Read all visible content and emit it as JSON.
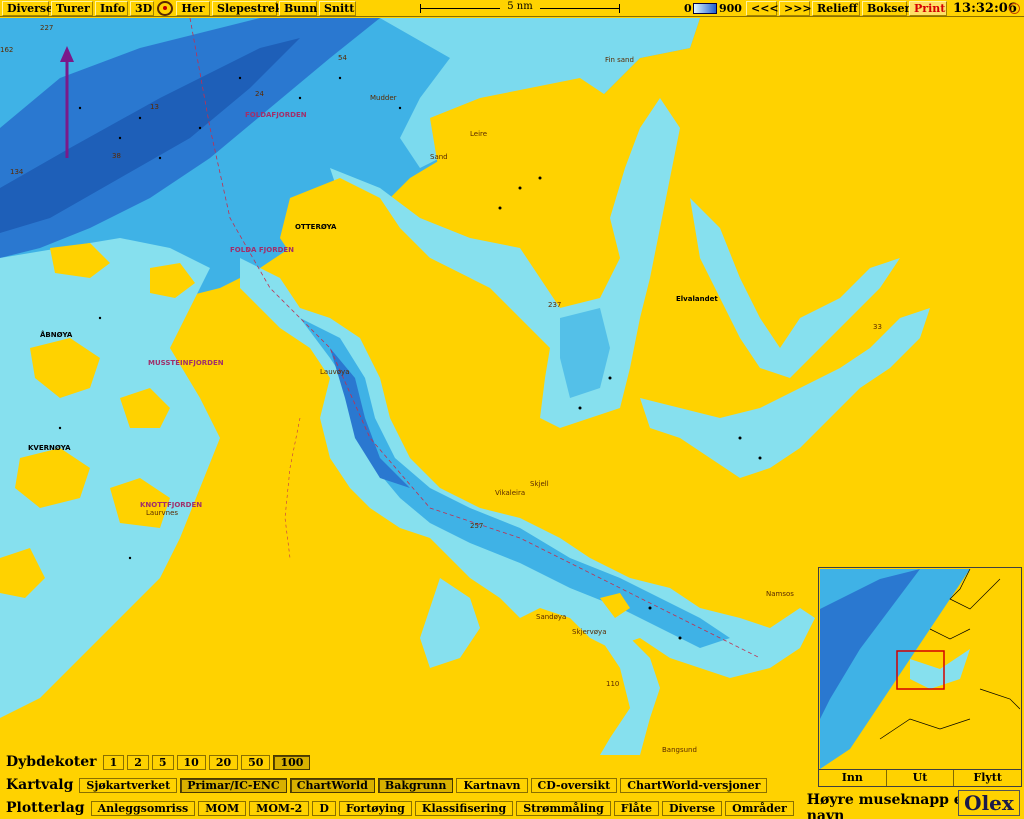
{
  "toolbar": {
    "buttons": [
      "Diverse",
      "Turer",
      "Info",
      "3D",
      "Her",
      "Slepestrek",
      "Bunn",
      "Snitt"
    ],
    "scale_label": "5 nm",
    "depth_min": "0",
    "depth_max": "900",
    "prev_label": "<<<",
    "next_label": ">>>",
    "relief_label": "Relieff",
    "boxes_label": "Bokser",
    "print_label": "Print",
    "clock": "13:32:06"
  },
  "map": {
    "place_names": [
      "FOLDAFJORDEN",
      "OTTERØYA",
      "ÅBNØYA",
      "KVERNØYA",
      "MUSSTEINFJORDEN",
      "KNOTTFJORDEN",
      "FOLDA FJORDEN",
      "Namsos",
      "Bangsund",
      "Skjervøya",
      "Leire",
      "Mudder",
      "Sand",
      "Skjell",
      "Fin sand",
      "Laurvnes",
      "Elvalandet",
      "Lauvøya",
      "Sandøya",
      "Vikaleira"
    ],
    "depth_soundings": [
      "227",
      "162",
      "134",
      "24",
      "54",
      "13",
      "38",
      "237",
      "110",
      "257",
      "33"
    ]
  },
  "inset": {
    "zoom_in_label": "Inn",
    "zoom_out_label": "Ut",
    "move_label": "Flytt"
  },
  "depth_contours": {
    "title": "Dybdekoter",
    "options": [
      "1",
      "2",
      "5",
      "10",
      "20",
      "50",
      "100"
    ],
    "selected": "100"
  },
  "chart_select": {
    "title": "Kartvalg",
    "options": [
      "Sjøkartverket",
      "Primar/IC-ENC",
      "ChartWorld",
      "Bakgrunn",
      "Kartnavn",
      "CD-oversikt",
      "ChartWorld-versjoner"
    ],
    "active": [
      "Primar/IC-ENC",
      "ChartWorld",
      "Bakgrunn"
    ]
  },
  "plot_layers": {
    "title": "Plotterlag",
    "options": [
      "Anleggsomriss",
      "MOM",
      "MOM-2",
      "D",
      "Fortøying",
      "Klassifisering",
      "Strømmåling",
      "Flåte",
      "Diverse",
      "Områder"
    ],
    "hint": "Høyre museknapp endrer navn"
  },
  "logo": "Olex",
  "colors": {
    "land": "#ffd200",
    "shallow_water": "#86e0ee",
    "mid_water": "#3fb2e6",
    "deep_water": "#2a78d0",
    "print_text": "#d40000"
  }
}
